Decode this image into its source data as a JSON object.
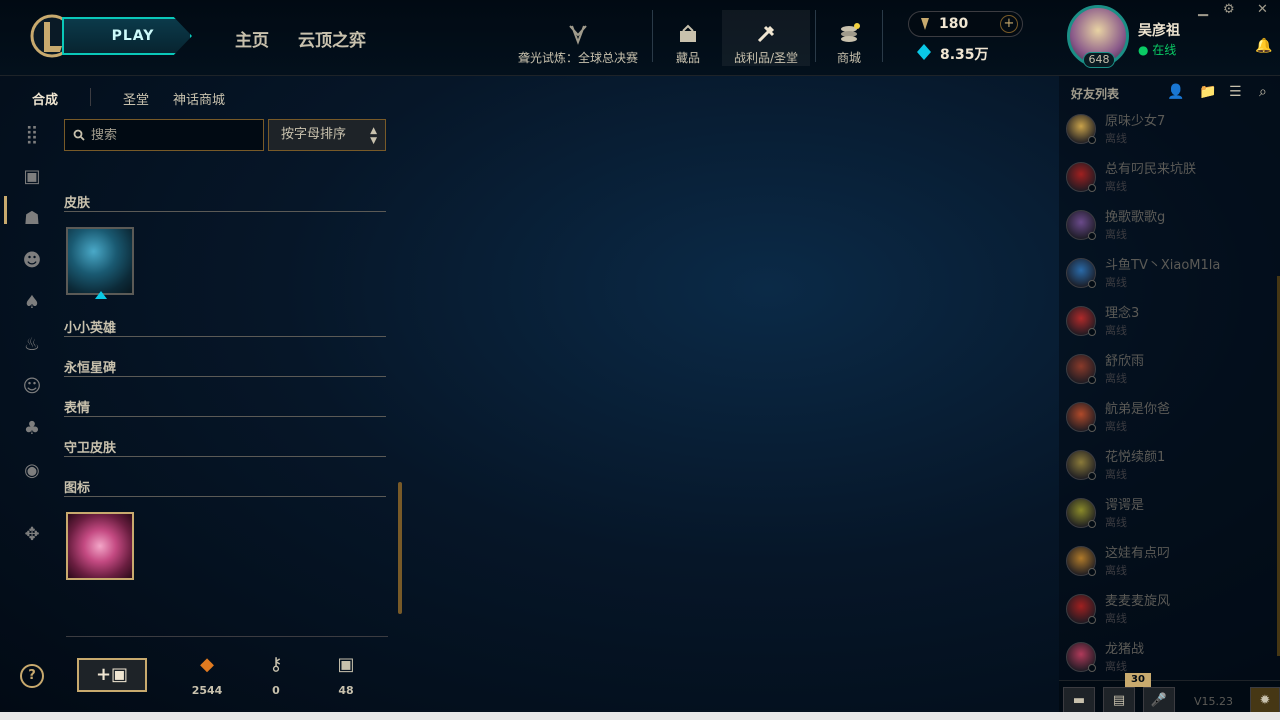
{
  "topbar": {
    "play_label": "PLAY",
    "nav": [
      "主页",
      "云顶之弈"
    ],
    "items": [
      {
        "label": "聋光试炼：全球总决赛",
        "icon": "trophy-icon"
      },
      {
        "label": "藏品",
        "icon": "collection-icon"
      },
      {
        "label": "战利品/圣堂",
        "icon": "hammer-icon",
        "active": true
      },
      {
        "label": "商城",
        "icon": "store-icon"
      }
    ],
    "rp_value": "180",
    "be_value": "8.35万",
    "level": "648",
    "username": "吴彦祖",
    "status": "在线"
  },
  "subtabs": [
    "合成",
    "圣堂",
    "神话商城"
  ],
  "search": {
    "placeholder": "搜索"
  },
  "sort": {
    "label": "按字母排序"
  },
  "categories": [
    "皮肤",
    "小小英雄",
    "永恒星碑",
    "表情",
    "守卫皮肤",
    "图标"
  ],
  "stats": [
    {
      "icon": "orange-essence-icon",
      "value": "2544"
    },
    {
      "icon": "key-icon",
      "value": "0"
    },
    {
      "icon": "chest-icon",
      "value": "48"
    }
  ],
  "friends": {
    "title": "好友列表",
    "list": [
      {
        "name": "原味少女7",
        "status": "离线",
        "color": "#c9a24a"
      },
      {
        "name": "总有叼民来坑朕",
        "status": "离线",
        "color": "#a02020"
      },
      {
        "name": "挽歌歌歌g",
        "status": "离线",
        "color": "#6a4a8a"
      },
      {
        "name": "斗鱼TV丶XiaoM1la",
        "status": "离线",
        "color": "#2a6aa8"
      },
      {
        "name": "理念3",
        "status": "离线",
        "color": "#b02a2a"
      },
      {
        "name": "舒欣雨",
        "status": "离线",
        "color": "#8a3a2a"
      },
      {
        "name": "航弟是你爸",
        "status": "离线",
        "color": "#b04a2a"
      },
      {
        "name": "花悦续颜1",
        "status": "离线",
        "color": "#8a7a3a"
      },
      {
        "name": "谔谔是",
        "status": "离线",
        "color": "#8a8a2a"
      },
      {
        "name": "这娃有点叼",
        "status": "离线",
        "color": "#b07a2a"
      },
      {
        "name": "麦麦麦旋风",
        "status": "离线",
        "color": "#a02020"
      },
      {
        "name": "龙猪战",
        "status": "离线",
        "color": "#b03a5a"
      }
    ],
    "badge": "30",
    "version": "V15.23"
  }
}
